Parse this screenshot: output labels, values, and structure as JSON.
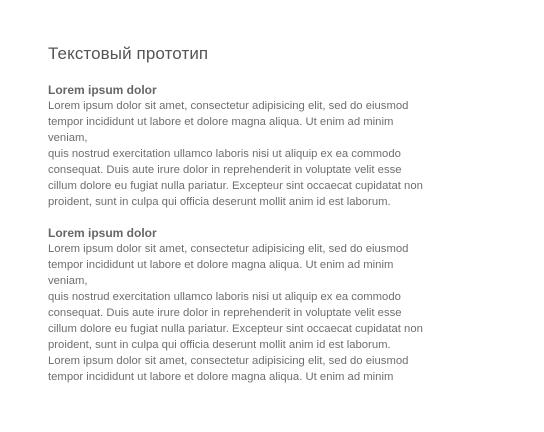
{
  "document": {
    "title": "Текстовый прототип",
    "sections": [
      {
        "heading": "Lorem ipsum dolor",
        "lines": [
          "Lorem ipsum dolor sit amet, consectetur adipisicing elit, sed do eiusmod",
          "tempor incididunt ut labore et dolore magna aliqua. Ut enim ad minim",
          "veniam,",
          "quis nostrud exercitation ullamco laboris nisi ut aliquip ex ea commodo",
          "consequat. Duis aute irure dolor in reprehenderit in voluptate velit esse",
          "cillum dolore eu fugiat nulla pariatur. Excepteur sint occaecat cupidatat non",
          "proident, sunt in culpa qui officia deserunt mollit anim id est laborum."
        ]
      },
      {
        "heading": "Lorem ipsum dolor",
        "lines": [
          "Lorem ipsum dolor sit amet, consectetur adipisicing elit, sed do eiusmod",
          "tempor incididunt ut labore et dolore magna aliqua. Ut enim ad minim",
          "veniam,",
          "quis nostrud exercitation ullamco laboris nisi ut aliquip ex ea commodo",
          "consequat. Duis aute irure dolor in reprehenderit in voluptate velit esse",
          "cillum dolore eu fugiat nulla pariatur. Excepteur sint occaecat cupidatat non",
          "proident, sunt in culpa qui officia deserunt mollit anim id est laborum.",
          "Lorem ipsum dolor sit amet, consectetur adipisicing elit, sed do eiusmod",
          "tempor incididunt ut labore et dolore magna aliqua. Ut enim ad minim"
        ]
      }
    ]
  }
}
